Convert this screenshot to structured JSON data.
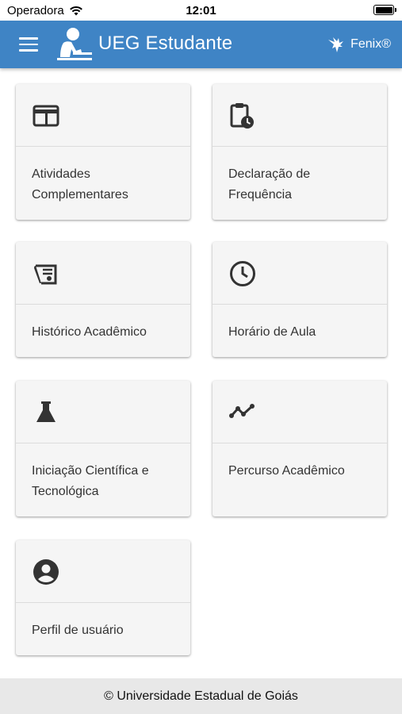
{
  "status_bar": {
    "carrier": "Operadora",
    "time": "12:01"
  },
  "app_bar": {
    "title": "UEG Estudante",
    "fenix_label": "Fenix®"
  },
  "cards": [
    {
      "label": "Atividades Complementares",
      "icon": "credit-card-icon"
    },
    {
      "label": "Declaração de Frequência",
      "icon": "clipboard-clock-icon"
    },
    {
      "label": "Histórico Acadêmico",
      "icon": "diploma-icon"
    },
    {
      "label": "Horário de Aula",
      "icon": "clock-icon"
    },
    {
      "label": "Iniciação Científica e Tecnológica",
      "icon": "flask-icon"
    },
    {
      "label": "Percurso Acadêmico",
      "icon": "timeline-icon"
    },
    {
      "label": "Perfil de usuário",
      "icon": "account-circle-icon"
    }
  ],
  "footer": {
    "text": "© Universidade Estadual de Goiás"
  },
  "colors": {
    "app_bar": "#3f84c5",
    "card": "#f5f5f5",
    "footer": "#e8e8e8"
  }
}
